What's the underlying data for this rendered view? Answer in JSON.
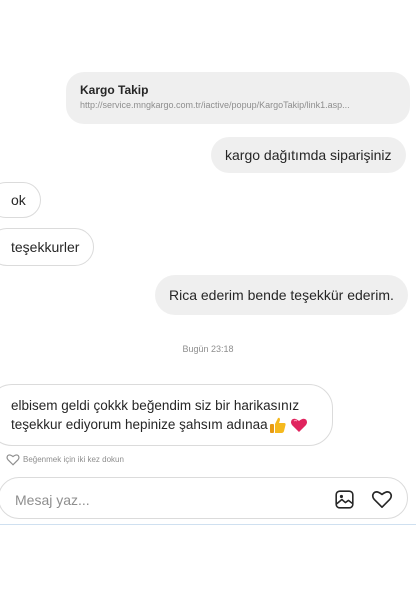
{
  "link_preview": {
    "title": "Kargo Takip",
    "url": "http://service.mngkargo.com.tr/iactive/popup/KargoTakip/link1.asp..."
  },
  "messages": [
    {
      "text": "kargo dağıtımda siparişiniz",
      "direction": "outgoing"
    },
    {
      "text": "ok",
      "direction": "incoming"
    },
    {
      "text": "teşekkurler",
      "direction": "incoming"
    },
    {
      "text": "Rica ederim bende teşekkür ederim.",
      "direction": "outgoing"
    }
  ],
  "timestamp": "Bugün 23:18",
  "last_message": {
    "line1": "elbisem geldi çokkk beğendim siz bir harikasınız",
    "line2": "teşekkur ediyorum hepinize şahsım adınaa",
    "emoji_icons": [
      "thumbs-up-icon",
      "heart-emoji-icon"
    ]
  },
  "like_hint": "Beğenmek için iki kez dokun",
  "composer": {
    "placeholder": "Mesaj yaz...",
    "icons": [
      "image-icon",
      "heart-icon"
    ]
  },
  "colors": {
    "bubble_outgoing": "#efefef",
    "bubble_incoming_border": "#dbdbdb",
    "muted_text": "#8e8e8e",
    "heart_emoji": "#e0245e",
    "thumbs_up": "#f5b91e"
  }
}
